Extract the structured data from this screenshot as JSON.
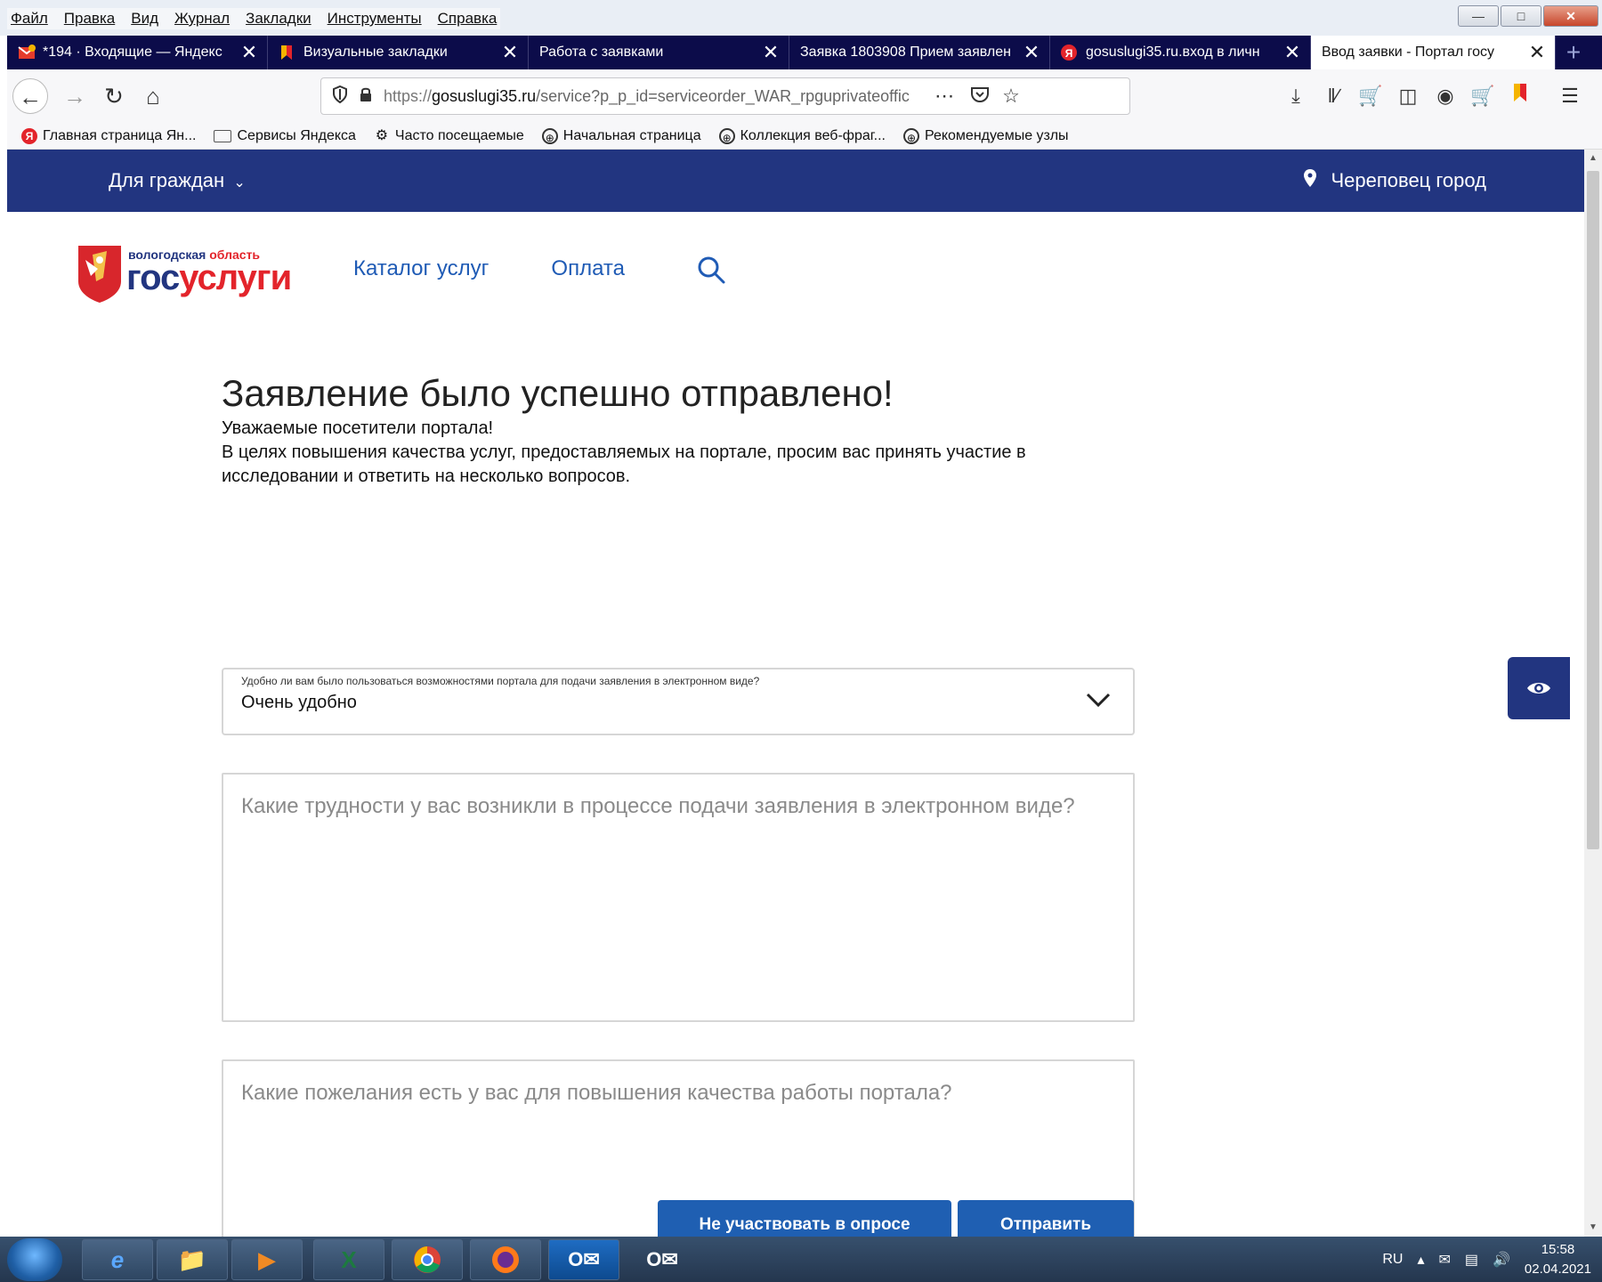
{
  "menubar": {
    "items": [
      "Файл",
      "Правка",
      "Вид",
      "Журнал",
      "Закладки",
      "Инструменты",
      "Справка"
    ]
  },
  "tabs": [
    {
      "title": "*194 · Входящие — Яндекс",
      "icon": "mail-icon"
    },
    {
      "title": "Визуальные закладки",
      "icon": "bookmark-flag-icon"
    },
    {
      "title": "Работа с заявками",
      "icon": ""
    },
    {
      "title": "Заявка 1803908 Прием заявлен",
      "icon": ""
    },
    {
      "title": "gosuslugi35.ru.вход в личн",
      "icon": "yandex-icon"
    },
    {
      "title": "Ввод заявки - Портал госу",
      "icon": "",
      "active": true
    }
  ],
  "navbar": {
    "url_scheme": "https://",
    "url_host": "gosuslugi35.ru",
    "url_path": "/service?p_p_id=serviceorder_WAR_rpguprivateofficep"
  },
  "bookmarks": [
    "Главная страница Ян...",
    "Сервисы Яндекса",
    "Часто посещаемые",
    "Начальная страница",
    "Коллекция веб-фраг...",
    "Рекомендуемые узлы"
  ],
  "site": {
    "citizens": "Для граждан",
    "city": "Череповец город",
    "logo_region_1": "вологодская",
    "logo_region_2": "область",
    "logo_gos": "гос",
    "logo_uslugi": "услуги",
    "nav_catalog": "Каталог услуг",
    "nav_payment": "Оплата"
  },
  "form": {
    "title": "Заявление было успешно отправлено!",
    "intro_1": "Уважаемые посетители портала!",
    "intro_2": "В целях повышения качества услуг, предоставляемых на портале, просим вас принять участие в исследовании и ответить на несколько вопросов.",
    "select_label": "Удобно ли вам было пользоваться возможностями портала для подачи заявления в электронном виде?",
    "select_value": "Очень удобно",
    "q1_placeholder": "Какие трудности у вас возникли в процессе подачи заявления в электронном виде?",
    "q2_placeholder": "Какие пожелания есть у вас для повышения качества работы портала?",
    "skip_label": "Не участвовать в опросе",
    "submit_label": "Отправить"
  },
  "tray": {
    "lang": "RU",
    "time": "15:58",
    "date": "02.04.2021"
  },
  "colors": {
    "header_blue": "#223580",
    "button_blue": "#1f5fb2",
    "link_blue": "#1f5bb5",
    "brand_red": "#e3242b"
  }
}
